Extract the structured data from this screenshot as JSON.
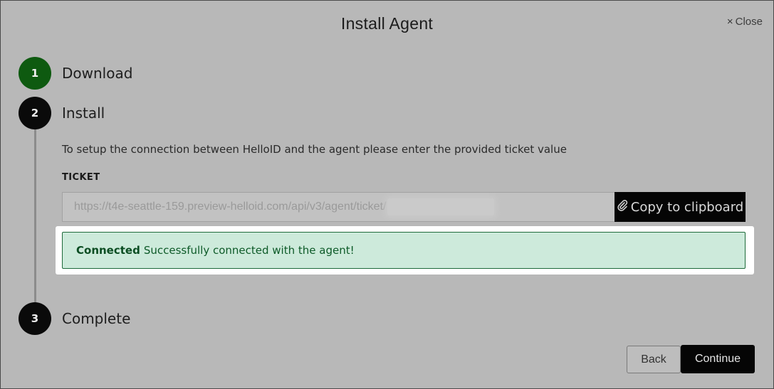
{
  "dialog": {
    "title": "Install Agent",
    "close_label": "Close",
    "close_icon": "×"
  },
  "steps": [
    {
      "number": "1",
      "label": "Download",
      "status": "done",
      "color": "#0e5a10"
    },
    {
      "number": "2",
      "label": "Install",
      "status": "active",
      "color": "#0a0a0a"
    },
    {
      "number": "3",
      "label": "Complete",
      "status": "pending",
      "color": "#0a0a0a"
    }
  ],
  "install": {
    "description": "To setup the connection between HelloID and the agent please enter the provided ticket value",
    "ticket_label": "TICKET",
    "ticket_value": "https://t4e-seattle-159.preview-helloid.com/api/v3/agent/ticket/",
    "copy_icon": "paperclip-icon",
    "copy_label": "Copy to clipboard"
  },
  "alert": {
    "strong": "Connected",
    "message": "Successfully connected with the agent!",
    "color": "#cdeadb"
  },
  "footer": {
    "back_label": "Back",
    "continue_label": "Continue"
  }
}
